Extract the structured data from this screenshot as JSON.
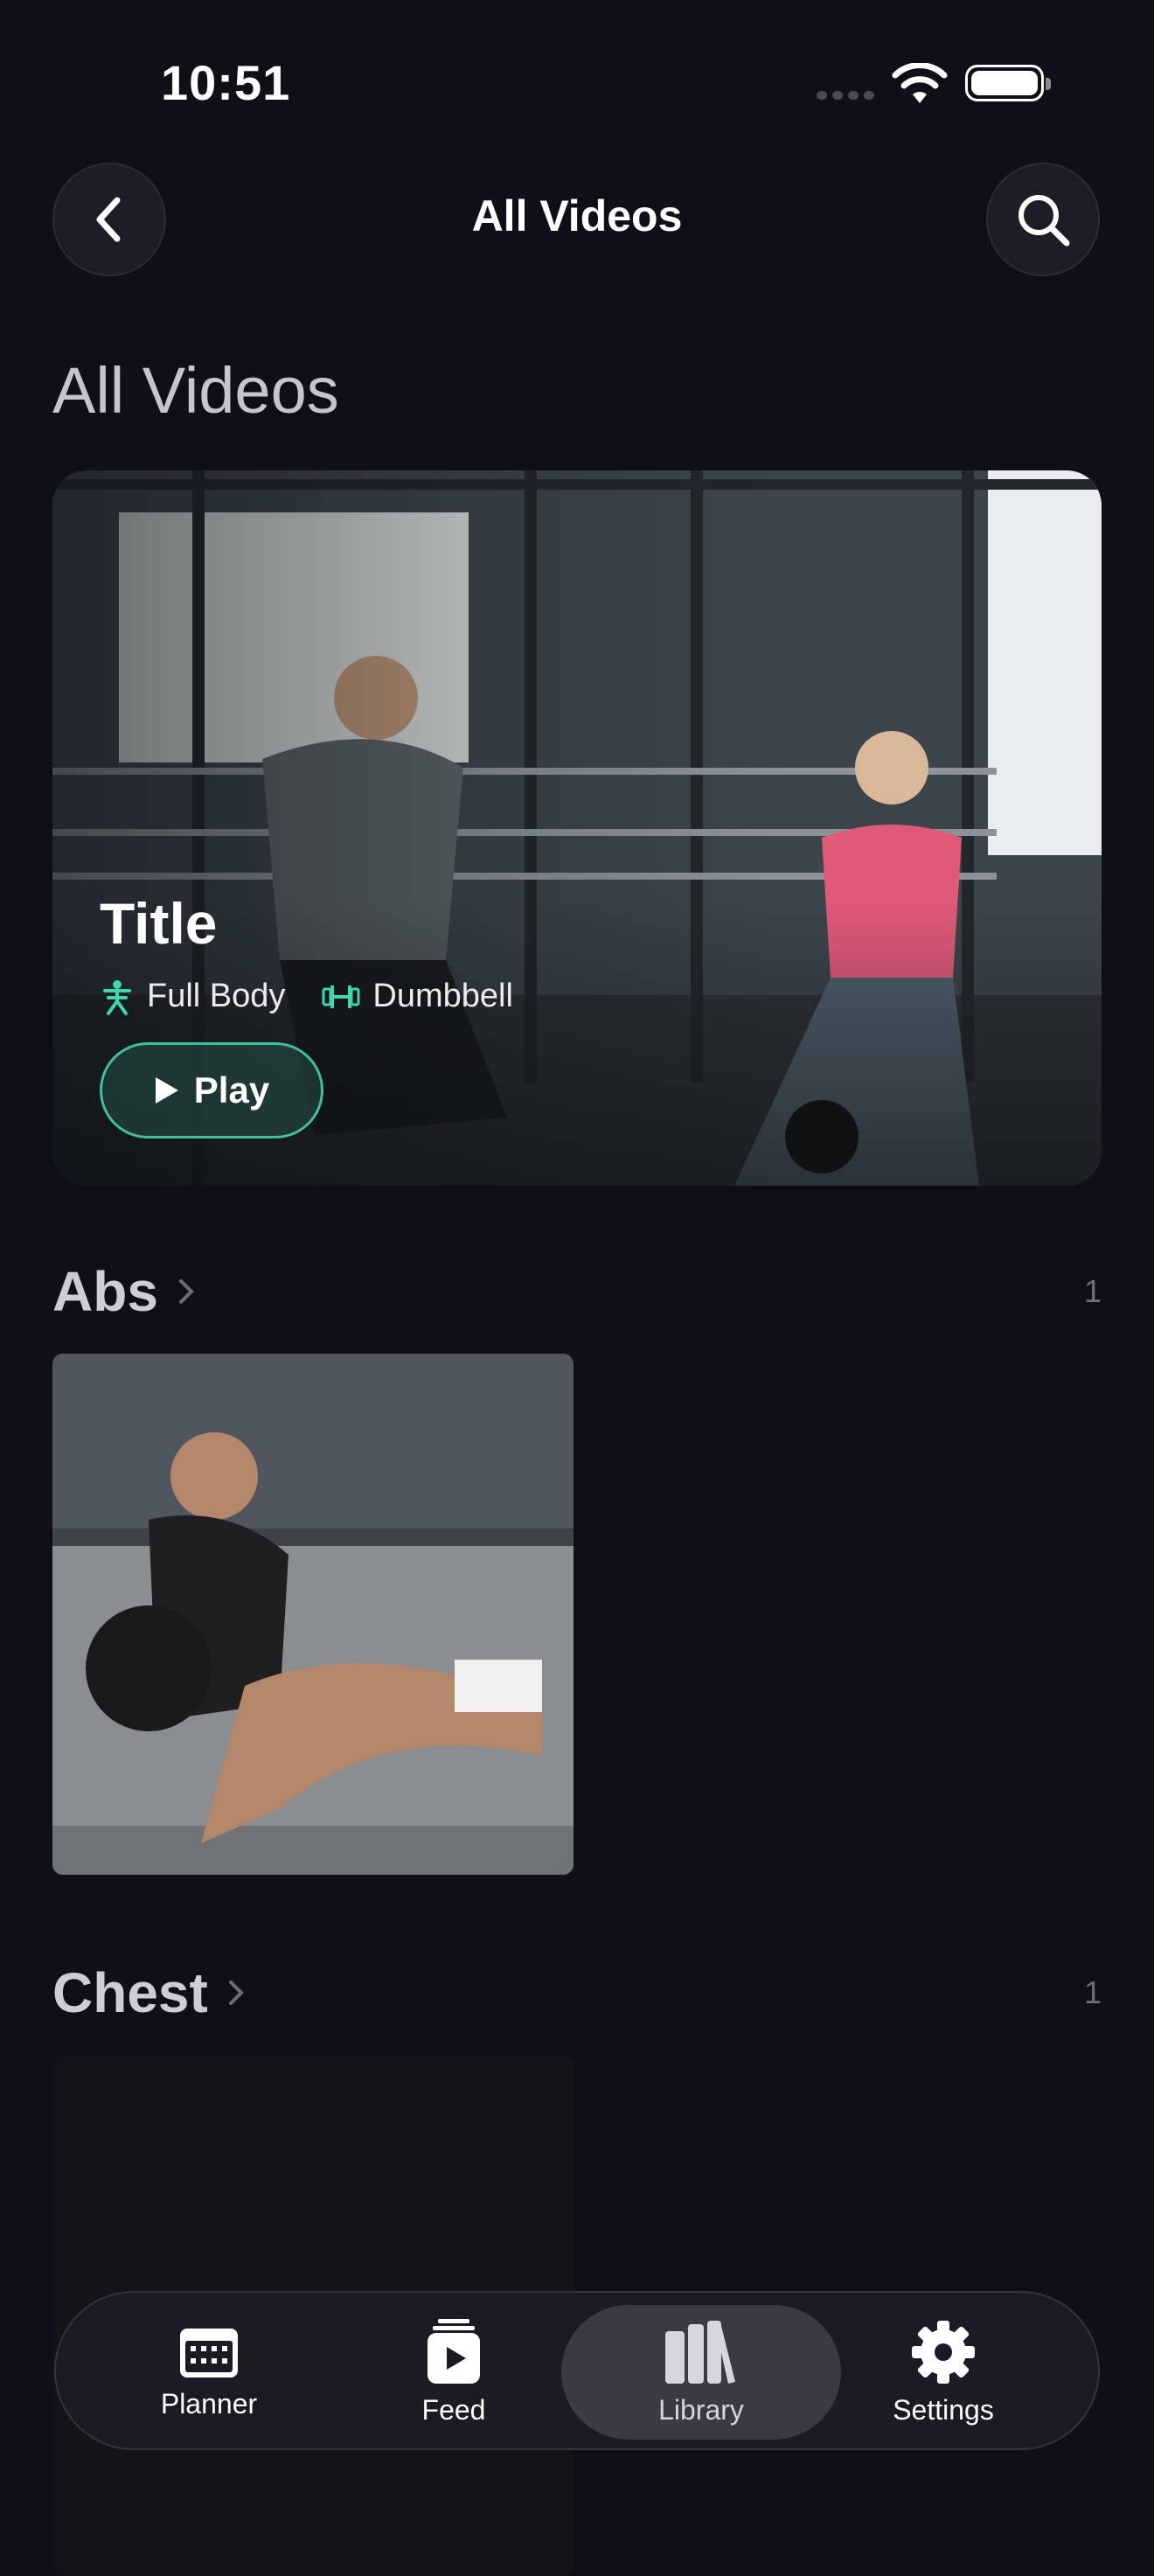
{
  "status_bar": {
    "time": "10:51"
  },
  "nav": {
    "title": "All Videos",
    "back_icon": "chevron-left-icon",
    "search_icon": "search-icon"
  },
  "heading": "All Videos",
  "hero": {
    "title": "Title",
    "tags": [
      {
        "icon": "full-body-icon",
        "label": "Full Body"
      },
      {
        "icon": "dumbbell-icon",
        "label": "Dumbbell"
      }
    ],
    "play_label": "Play",
    "accent": "#3fbfa0"
  },
  "categories": [
    {
      "name": "Abs",
      "count": "1"
    },
    {
      "name": "Chest",
      "count": "1"
    }
  ],
  "tabbar": {
    "items": [
      {
        "label": "Planner",
        "icon": "calendar-icon"
      },
      {
        "label": "Feed",
        "icon": "play-stack-icon"
      },
      {
        "label": "Library",
        "icon": "books-icon"
      },
      {
        "label": "Settings",
        "icon": "gear-icon"
      }
    ],
    "active": "Library"
  }
}
